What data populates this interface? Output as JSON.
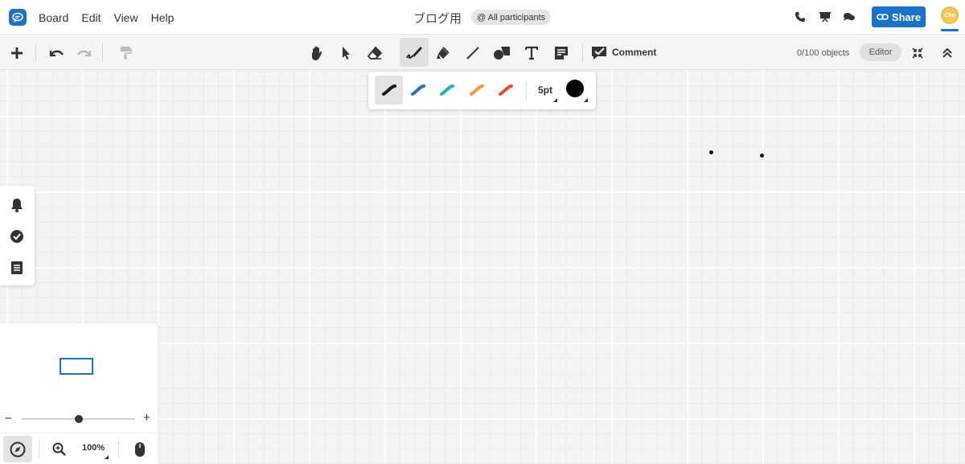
{
  "menubar": {
    "items": [
      "Board",
      "Edit",
      "View",
      "Help"
    ],
    "board_title": "ブログ用",
    "participants": "@ All participants",
    "share_label": "Share",
    "avatar_text": "Cha"
  },
  "toolbar": {
    "comment_label": "Comment",
    "objects_count": "0/100 objects",
    "editor_label": "Editor"
  },
  "pen_popup": {
    "colors": [
      "#1a1a1a",
      "#1f76c2",
      "#25b3b3",
      "#f59a2e",
      "#ef4c3a"
    ],
    "size_label": "5pt",
    "current_color": "#000000"
  },
  "minimap": {
    "zoom_label": "100%",
    "minus": "−",
    "plus": "+",
    "zoom_level": 0.5
  },
  "colors": {
    "accent": "#1a73c8"
  }
}
